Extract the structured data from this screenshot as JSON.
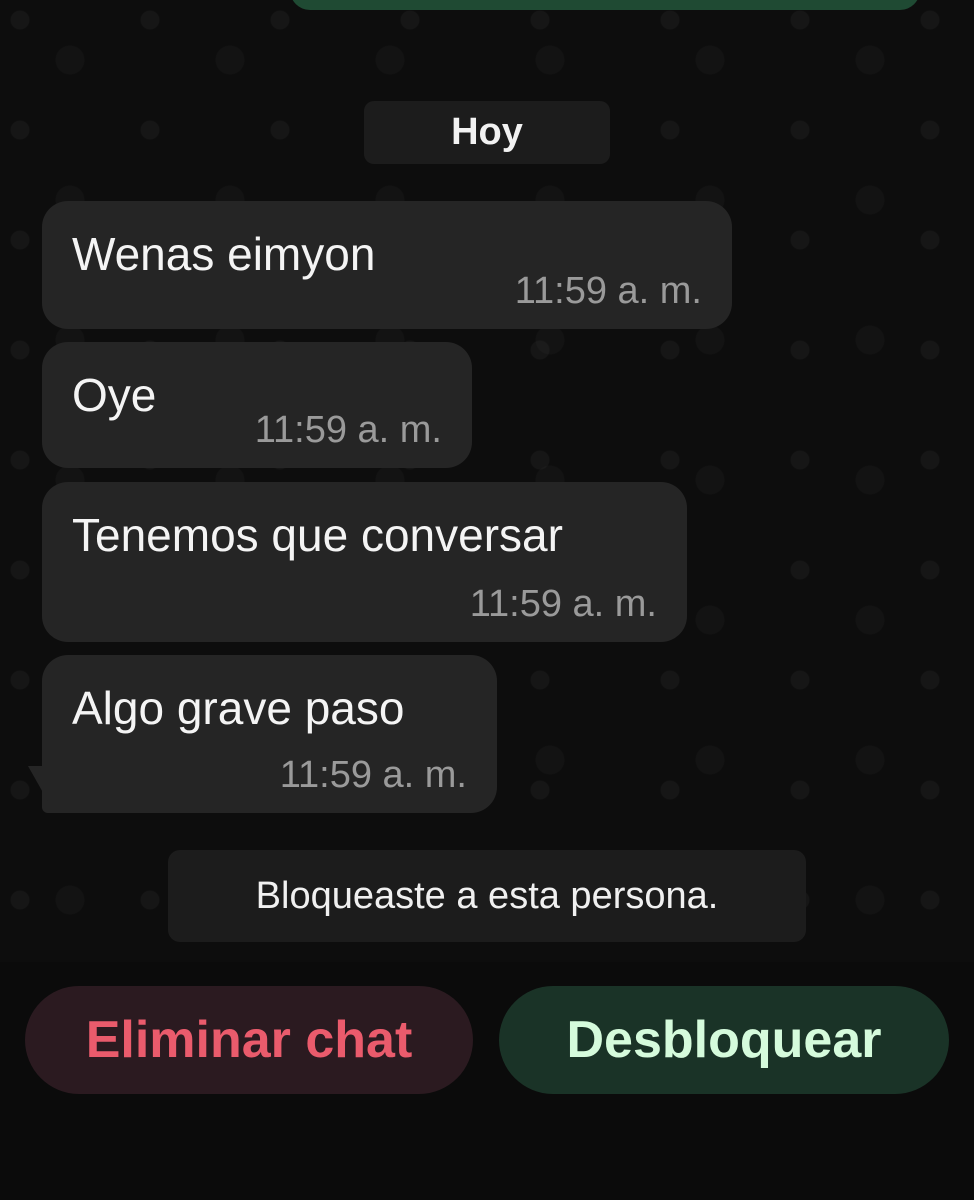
{
  "date_label": "Hoy",
  "messages": [
    {
      "text": "Wenas eimyon",
      "time": "11:59 a. m."
    },
    {
      "text": "Oye",
      "time": "11:59 a. m."
    },
    {
      "text": "Tenemos que conversar",
      "time": "11:59 a. m."
    },
    {
      "text": "Algo grave paso",
      "time": "11:59 a. m."
    }
  ],
  "system_notice": "Bloqueaste a esta persona.",
  "actions": {
    "delete_label": "Eliminar chat",
    "unblock_label": "Desbloquear"
  },
  "colors": {
    "background": "#0b0b0b",
    "bubble": "#252525",
    "delete_text": "#ea5b6c",
    "unblock_text": "#d5fbdc",
    "sent_bubble": "#1f4a33"
  }
}
